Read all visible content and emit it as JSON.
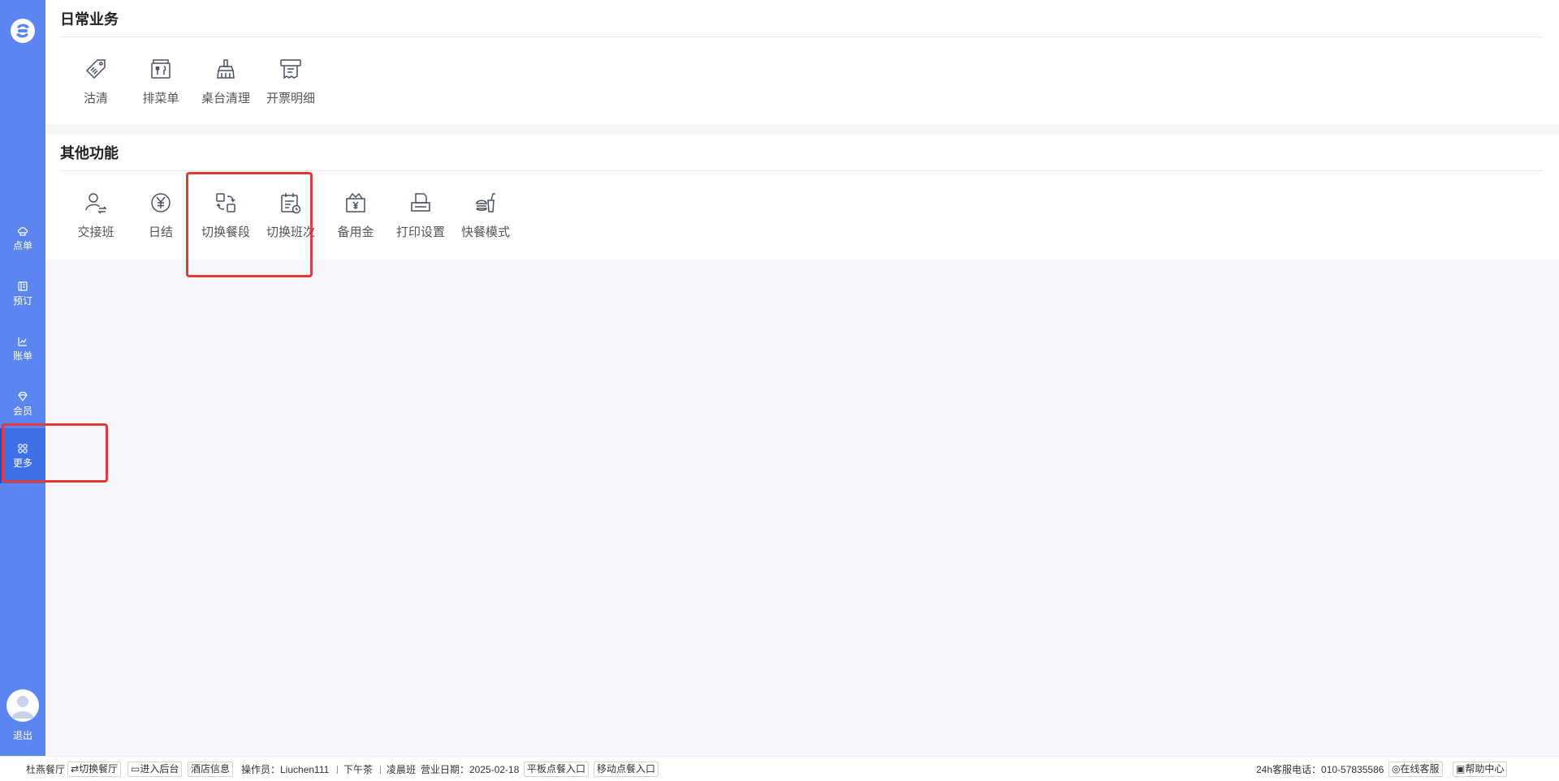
{
  "sidebar": {
    "items": [
      {
        "label": "点单",
        "icon": "chef-hat-icon"
      },
      {
        "label": "预订",
        "icon": "book-icon"
      },
      {
        "label": "账单",
        "icon": "chart-icon"
      },
      {
        "label": "会员",
        "icon": "diamond-icon"
      },
      {
        "label": "更多",
        "icon": "grid-icon",
        "active": true
      }
    ],
    "logout": "退出"
  },
  "daily": {
    "title": "日常业务",
    "items": [
      {
        "label": "沽清",
        "icon": "tag-icon"
      },
      {
        "label": "排菜单",
        "icon": "menu-icon"
      },
      {
        "label": "桌台清理",
        "icon": "broom-icon"
      },
      {
        "label": "开票明细",
        "icon": "receipt-icon"
      }
    ]
  },
  "other": {
    "title": "其他功能",
    "items": [
      {
        "label": "交接班",
        "icon": "handover-icon"
      },
      {
        "label": "日结",
        "icon": "yuan-circle-icon"
      },
      {
        "label": "切换餐段",
        "icon": "switch-icon"
      },
      {
        "label": "切换班次",
        "icon": "calendar-clock-icon"
      },
      {
        "label": "备用金",
        "icon": "wallet-icon"
      },
      {
        "label": "打印设置",
        "icon": "printer-icon"
      },
      {
        "label": "快餐模式",
        "icon": "fastfood-icon"
      }
    ]
  },
  "footer": {
    "restaurant": "杜燕餐厅",
    "switch_restaurant": "切换餐厅",
    "enter_backend": "进入后台",
    "hotel_info": "酒店信息",
    "operator": "操作员：Liuchen111",
    "meal_period": "下午茶",
    "shift": "凌晨班",
    "business_date": "营业日期：2025-02-18",
    "tablet_entry": "平板点餐入口",
    "mobile_entry": "移动点餐入口",
    "hotline": "24h客服电话：010-57835586",
    "online_service": "在线客服",
    "help_center": "帮助中心"
  },
  "colors": {
    "sidebar": "#5b86f0",
    "sidebar_active": "#3e6fe6",
    "highlight": "#e53935"
  }
}
